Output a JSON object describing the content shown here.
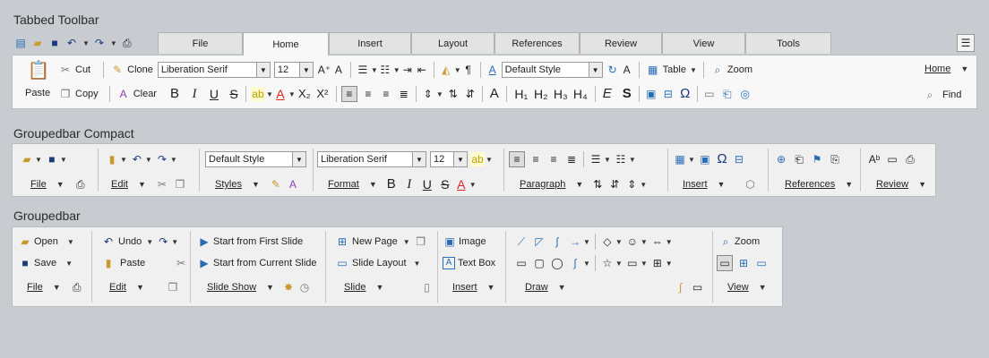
{
  "titles": {
    "tabbed": "Tabbed Toolbar",
    "compact": "Groupedbar Compact",
    "grouped": "Groupedbar"
  },
  "tabbed": {
    "tabs": [
      "File",
      "Home",
      "Insert",
      "Layout",
      "References",
      "Review",
      "View",
      "Tools"
    ],
    "active_tab": "Home",
    "cut": "Cut",
    "copy": "Copy",
    "paste": "Paste",
    "clone": "Clone",
    "clear": "Clear",
    "font_name": "Liberation Serif",
    "font_size": "12",
    "style": "Default Style",
    "table": "Table",
    "zoom": "Zoom",
    "home_menu": "Home",
    "find": "Find",
    "bold": "B",
    "italic": "I",
    "underline": "U",
    "strike": "S",
    "sub": "X₂",
    "sup": "X²",
    "h1": "H₁",
    "h2": "H₂",
    "h3": "H₃",
    "h4": "H₄",
    "emph": "E",
    "strong": "S",
    "plain": "A",
    "omega": "Ω",
    "grow": "A⁺",
    "shrink": "A",
    "pilcrow": "¶",
    "font_a": "A"
  },
  "compact": {
    "style": "Default Style",
    "font_name": "Liberation Serif",
    "font_size": "12",
    "bold": "B",
    "italic": "I",
    "underline": "U",
    "strike": "S",
    "font_a": "A",
    "omega": "Ω",
    "labels": {
      "file": "File",
      "edit": "Edit",
      "styles": "Styles",
      "format": "Format",
      "paragraph": "Paragraph",
      "insert": "Insert",
      "references": "References",
      "review": "Review"
    }
  },
  "grouped": {
    "open": "Open",
    "save": "Save",
    "file": "File",
    "undo": "Undo",
    "paste": "Paste",
    "edit": "Edit",
    "start_first": "Start from First Slide",
    "start_current": "Start from Current Slide",
    "slide_show": "Slide Show",
    "new_page": "New Page",
    "slide_layout": "Slide Layout",
    "slide": "Slide",
    "image": "Image",
    "text_box": "Text Box",
    "insert": "Insert",
    "draw": "Draw",
    "zoom": "Zoom",
    "view": "View"
  }
}
